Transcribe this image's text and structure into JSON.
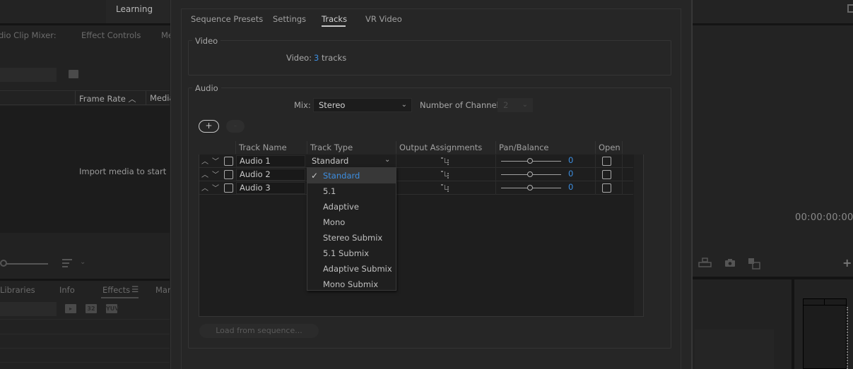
{
  "background": {
    "workspace_tab": "Learning",
    "left_panel_tabs": [
      "dio Clip Mixer:",
      "Effect Controls",
      "Me"
    ],
    "project_columns": [
      "Frame Rate",
      "Media"
    ],
    "empty_message": "Import media to start",
    "bottom_tabs": [
      "Libraries",
      "Info",
      "Effects",
      "Mar"
    ],
    "effect_icons": [
      "accelerated-effects-icon",
      "32-bit-icon",
      "yuv-icon"
    ],
    "program_timecode": "00:00:00:00"
  },
  "dialog": {
    "tabs": [
      {
        "label": "Sequence Presets",
        "active": false
      },
      {
        "label": "Settings",
        "active": false
      },
      {
        "label": "Tracks",
        "active": true
      },
      {
        "label": "VR Video",
        "active": false
      }
    ],
    "video": {
      "group_label": "Video",
      "label": "Video:",
      "count": "3",
      "unit": "tracks"
    },
    "audio": {
      "group_label": "Audio",
      "mix_label": "Mix:",
      "mix_value": "Stereo",
      "channels_label": "Number of Channels:",
      "channels_value": "2",
      "add_label": "+",
      "remove_label": "-",
      "columns": [
        "Track Name",
        "Track Type",
        "Output Assignments",
        "Pan/Balance",
        "Open"
      ],
      "tracks": [
        {
          "name": "Audio 1",
          "type": "Standard",
          "pan": "0",
          "open": false
        },
        {
          "name": "Audio 2",
          "type": "Standard",
          "pan": "0",
          "open": false
        },
        {
          "name": "Audio 3",
          "type": "Standard",
          "pan": "0",
          "open": false
        }
      ],
      "track_type_options": [
        "Standard",
        "5.1",
        "Adaptive",
        "Mono",
        "Stereo Submix",
        "5.1 Submix",
        "Adaptive Submix",
        "Mono Submix"
      ],
      "selected_type": "Standard",
      "load_button": "Load from sequence..."
    }
  },
  "colors": {
    "accent_blue": "#3d8ee0",
    "dialog_bg": "#262626",
    "panel_bg": "#1f1f1f"
  }
}
